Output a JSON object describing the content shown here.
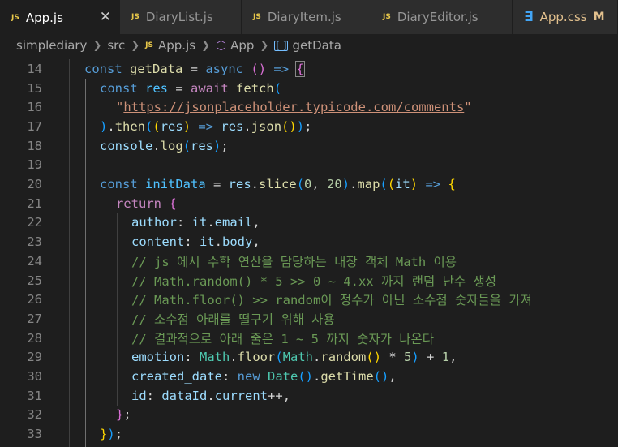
{
  "tabs": [
    {
      "label": "App.js",
      "icon": "js-file-icon",
      "active": true
    },
    {
      "label": "DiaryList.js",
      "icon": "js-file-icon"
    },
    {
      "label": "DiaryItem.js",
      "icon": "js-file-icon"
    },
    {
      "label": "DiaryEditor.js",
      "icon": "js-file-icon"
    },
    {
      "label": "App.css",
      "icon": "css-file-icon",
      "status": "M"
    }
  ],
  "file_icon_text": "JS",
  "close_glyph": "✕",
  "breadcrumb": [
    "simplediary",
    "src",
    "App.js",
    "App",
    "getData"
  ],
  "line_numbers": [
    "14",
    "15",
    "16",
    "17",
    "18",
    "19",
    "20",
    "21",
    "22",
    "23",
    "24",
    "25",
    "26",
    "27",
    "28",
    "29",
    "30",
    "31",
    "32",
    "33"
  ],
  "code": {
    "l14": {
      "const": "const",
      "name": "getData",
      "eq": " = ",
      "async": "async",
      "params": "()",
      "arrow": " => ",
      "brace": "{"
    },
    "l15": {
      "const": "const",
      "name": "res",
      "eq": " = ",
      "await": "await",
      "fetch": "fetch",
      "paren": "("
    },
    "l16": {
      "url": "\"https://jsonplaceholder.typicode.com/comments\""
    },
    "l17": {
      "close": ")",
      "dot": ".",
      "then": "then",
      "p1": "(",
      "p2": "(",
      "arg": "res",
      "p3": ")",
      "arrow": " => ",
      "obj": "res",
      "dot2": ".",
      "json": "json",
      "p4": "()",
      "p5": ")",
      "semi": ";"
    },
    "l18": {
      "obj": "console",
      "dot": ".",
      "method": "log",
      "p1": "(",
      "arg": "res",
      "p2": ")",
      "semi": ";"
    },
    "l20": {
      "const": "const",
      "name": "initData",
      "eq": " = ",
      "obj": "res",
      "dot": ".",
      "slice": "slice",
      "p1": "(",
      "a": "0",
      "comma": ", ",
      "b": "20",
      "p2": ")",
      "dot2": ".",
      "map": "map",
      "p3": "(",
      "p4": "(",
      "arg": "it",
      "p5": ")",
      "arrow": " => ",
      "brace": "{"
    },
    "l21": {
      "ret": "return",
      "brace": " {"
    },
    "l22": {
      "key": "author",
      "colon": ": ",
      "obj": "it",
      "dot": ".",
      "prop": "email",
      "comma": ","
    },
    "l23": {
      "key": "content",
      "colon": ": ",
      "obj": "it",
      "dot": ".",
      "prop": "body",
      "comma": ","
    },
    "l24": "// js 에서 수학 연산을 담당하는 내장 객체 Math 이용",
    "l25": "// Math.random() * 5 >> 0 ~ 4.xx 까지 랜덤 난수 생성",
    "l26": "// Math.floor() >> random이 정수가 아닌 소수점 숫자들을 가져",
    "l27": "// 소수점 아래를 떨구기 위해 사용",
    "l28": "// 결과적으로 아래 줄은 1 ~ 5 까지 숫자가 나온다",
    "l29": {
      "key": "emotion",
      "colon": ": ",
      "math": "Math",
      "dot": ".",
      "floor": "floor",
      "p1": "(",
      "math2": "Math",
      "dot2": ".",
      "random": "random",
      "p2": "()",
      "mul": " * ",
      "five": "5",
      "p3": ")",
      "plus": " + ",
      "one": "1",
      "comma": ","
    },
    "l30": {
      "key": "created_date",
      "colon": ": ",
      "new": "new",
      "cls": "Date",
      "p1": "()",
      "dot": ".",
      "gettime": "getTime",
      "p2": "()",
      "comma": ","
    },
    "l31": {
      "key": "id",
      "colon": ": ",
      "obj": "dataId",
      "dot": ".",
      "prop": "current",
      "inc": "++",
      "comma": ","
    },
    "l32": {
      "brace": "}",
      "semi": ";"
    },
    "l33": {
      "brace": "}",
      "paren": ")",
      "semi": ";"
    }
  }
}
